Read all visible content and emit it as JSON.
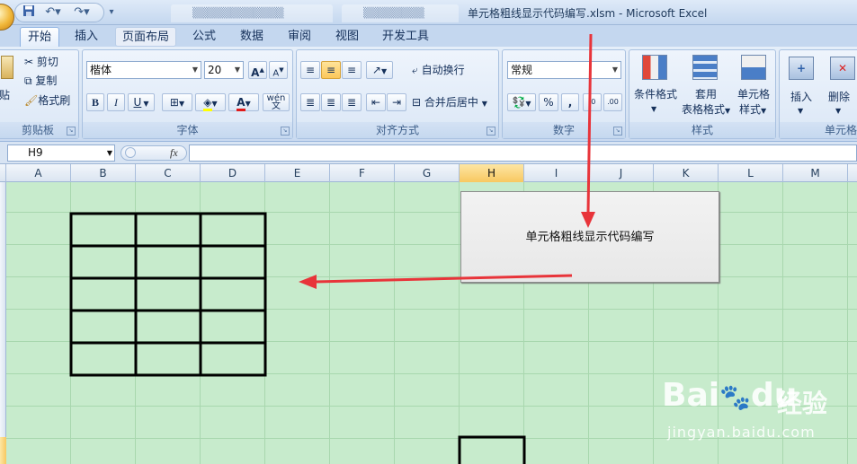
{
  "window": {
    "title": "单元格粗线显示代码编写.xlsm - Microsoft Excel"
  },
  "tabs": [
    {
      "label": "开始",
      "active": true
    },
    {
      "label": "插入"
    },
    {
      "label": "页面布局",
      "highlighted": true
    },
    {
      "label": "公式"
    },
    {
      "label": "数据"
    },
    {
      "label": "审阅"
    },
    {
      "label": "视图"
    },
    {
      "label": "开发工具"
    }
  ],
  "clipboard": {
    "paste": "贴",
    "cut": "剪切",
    "copy": "复制",
    "format_painter": "格式刷",
    "group": "剪贴板"
  },
  "font": {
    "name": "楷体",
    "size": "20",
    "bold": "B",
    "italic": "I",
    "underline": "U",
    "phonetic": "wén 文",
    "group": "字体"
  },
  "alignment": {
    "wrap": "自动换行",
    "merge": "合并后居中",
    "group": "对齐方式"
  },
  "number": {
    "format": "常规",
    "percent": "%",
    "comma": ",",
    "group": "数字"
  },
  "styles": {
    "conditional": "条件格式",
    "table_a": "套用",
    "table_b": "表格格式",
    "cell_a": "单元格",
    "cell_b": "样式",
    "group": "样式"
  },
  "cells": {
    "insert": "插入",
    "delete": "删除",
    "group": "单元格"
  },
  "formula_bar": {
    "name_box": "H9",
    "fx": "fx"
  },
  "columns": [
    "A",
    "B",
    "C",
    "D",
    "E",
    "F",
    "G",
    "H",
    "I",
    "J",
    "K",
    "L",
    "M"
  ],
  "selected_column": "H",
  "macro_button": {
    "label": "单元格粗线显示代码编写"
  },
  "watermark": {
    "brand": "Bai",
    "brand2": "du",
    "site": "经验",
    "url": "jingyan.baidu.com"
  },
  "colors": {
    "arrow": "#e8343a",
    "grid": "#a8d7ae",
    "sheet_bg": "#c7ebcc",
    "thick_border": "#000000"
  }
}
